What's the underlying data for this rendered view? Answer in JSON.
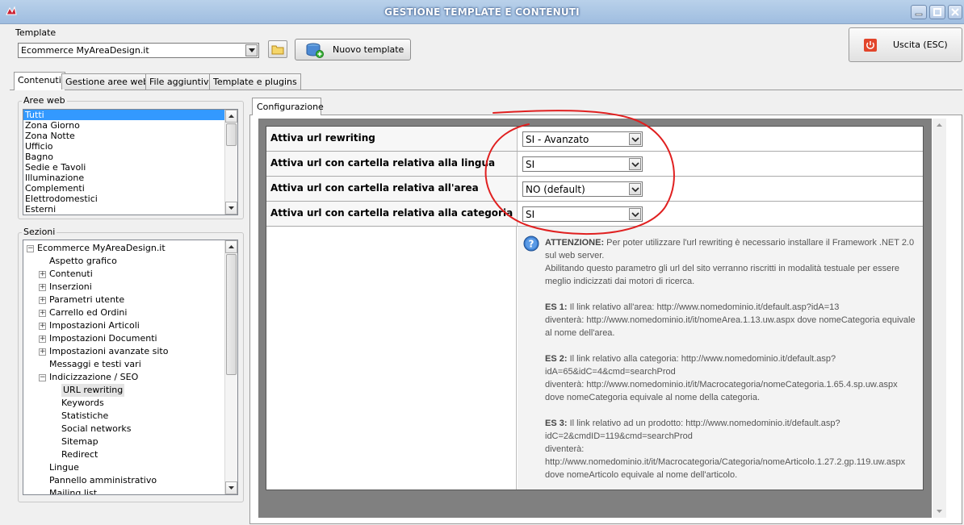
{
  "window": {
    "title": "GESTIONE TEMPLATE E CONTENUTI"
  },
  "template": {
    "group_label": "Template",
    "selected": "Ecommerce MyAreaDesign.it",
    "new_button": "Nuovo template"
  },
  "exit_button": "Uscita (ESC)",
  "tabs": [
    "Contenuti",
    "Gestione aree web",
    "File aggiuntivi",
    "Template e plugins"
  ],
  "aree_web": {
    "label": "Aree web",
    "items": [
      "Tutti",
      "Zona Giorno",
      "Zona Notte",
      "Ufficio",
      "Bagno",
      "Sedie e Tavoli",
      "Illuminazione",
      "Complementi",
      "Elettrodomestici",
      "Esterni"
    ]
  },
  "sezioni": {
    "label": "Sezioni",
    "items": [
      {
        "text": "Ecommerce MyAreaDesign.it",
        "level": 0,
        "expander": "-"
      },
      {
        "text": "Aspetto grafico",
        "level": 1,
        "expander": ""
      },
      {
        "text": "Contenuti",
        "level": 1,
        "expander": "+"
      },
      {
        "text": "Inserzioni",
        "level": 1,
        "expander": "+"
      },
      {
        "text": "Parametri utente",
        "level": 1,
        "expander": "+"
      },
      {
        "text": "Carrello ed Ordini",
        "level": 1,
        "expander": "+"
      },
      {
        "text": "Impostazioni Articoli",
        "level": 1,
        "expander": "+"
      },
      {
        "text": "Impostazioni Documenti",
        "level": 1,
        "expander": "+"
      },
      {
        "text": "Impostazioni avanzate sito",
        "level": 1,
        "expander": "+"
      },
      {
        "text": "Messaggi e testi vari",
        "level": 1,
        "expander": ""
      },
      {
        "text": "Indicizzazione / SEO",
        "level": 1,
        "expander": "-"
      },
      {
        "text": "URL rewriting",
        "level": 2,
        "expander": "",
        "selected": true
      },
      {
        "text": "Keywords",
        "level": 2,
        "expander": ""
      },
      {
        "text": "Statistiche",
        "level": 2,
        "expander": ""
      },
      {
        "text": "Social networks",
        "level": 2,
        "expander": ""
      },
      {
        "text": "Sitemap",
        "level": 2,
        "expander": ""
      },
      {
        "text": "Redirect",
        "level": 2,
        "expander": ""
      },
      {
        "text": "Lingue",
        "level": 1,
        "expander": ""
      },
      {
        "text": "Pannello amministrativo",
        "level": 1,
        "expander": ""
      },
      {
        "text": "Mailing list",
        "level": 1,
        "expander": ""
      }
    ]
  },
  "config": {
    "tab_label": "Configurazione",
    "rows": [
      {
        "label": "Attiva url rewriting",
        "value": "SI - Avanzato"
      },
      {
        "label": "Attiva url con cartella relativa alla lingua",
        "value": "SI"
      },
      {
        "label": "Attiva url con cartella relativa all'area",
        "value": "NO (default)"
      },
      {
        "label": "Attiva url con cartella relativa alla categoria",
        "value": "SI"
      }
    ]
  },
  "info": {
    "p1_bold": "ATTENZIONE:",
    "p1_text": " Per poter utilizzare l'url rewriting è necessario installare il Framework .NET 2.0 sul web server.",
    "p1_text2": "Abilitando questo parametro gli url del sito verranno riscritti in modalità testuale per essere meglio indicizzati dai motori di ricerca.",
    "es1_bold": "ES 1:",
    "es1_text": " Il link relativo all'area: http://www.nomedominio.it/default.asp?idA=13",
    "es1_text2": "diventerà: http://www.nomedominio.it/it/nomeArea.1.13.uw.aspx dove nomeCategoria equivale al nome dell'area.",
    "es2_bold": "ES 2:",
    "es2_text": " Il link relativo alla categoria: http://www.nomedominio.it/default.asp?idA=65&idC=4&cmd=searchProd",
    "es2_text2": "diventerà: http://www.nomedominio.it/it/Macrocategoria/nomeCategoria.1.65.4.sp.uw.aspx dove nomeCategoria equivale al nome della categoria.",
    "es3_bold": "ES 3:",
    "es3_text": " Il link relativo ad un prodotto: http://www.nomedominio.it/default.asp?idC=2&cmdID=119&cmd=searchProd",
    "es3_text2": "diventerà:",
    "es3_text3": "http://www.nomedominio.it/it/Macrocategoria/Categoria/nomeArticolo.1.27.2.gp.119.uw.aspx dove nomeArticolo equivale al nome dell'articolo."
  },
  "colors": {
    "selection": "#3399ff",
    "annotation": "#e02020"
  }
}
